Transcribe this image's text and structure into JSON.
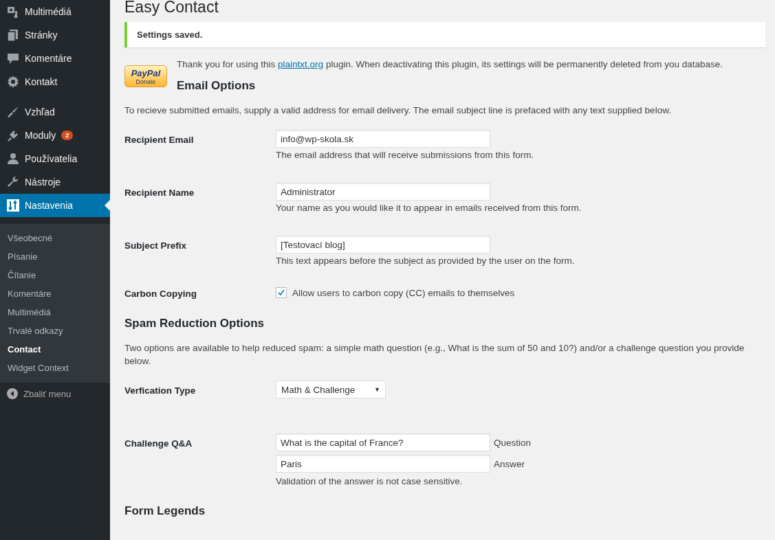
{
  "sidebar": {
    "menu_groups": [
      [
        {
          "label": "Multimédiá",
          "selected": false
        },
        {
          "label": "Stránky",
          "selected": false
        },
        {
          "label": "Komentáre",
          "selected": false
        },
        {
          "label": "Kontakt",
          "selected": false
        }
      ],
      [
        {
          "label": "Vzhľad",
          "selected": false
        },
        {
          "label": "Moduly",
          "selected": false,
          "badge": "2"
        },
        {
          "label": "Používatelia",
          "selected": false
        },
        {
          "label": "Nástroje",
          "selected": false
        },
        {
          "label": "Nastavenia",
          "selected": true
        }
      ]
    ],
    "submenu": [
      {
        "label": "Všeobecné",
        "selected": false
      },
      {
        "label": "Písanie",
        "selected": false
      },
      {
        "label": "Čítanie",
        "selected": false
      },
      {
        "label": "Komentáre",
        "selected": false
      },
      {
        "label": "Multimédiá",
        "selected": false
      },
      {
        "label": "Trvalé odkazy",
        "selected": false
      },
      {
        "label": "Contact",
        "selected": true
      },
      {
        "label": "Widget Context",
        "selected": false
      }
    ],
    "collapse": "Zbaliť menu"
  },
  "page": {
    "title": "Easy Contact",
    "notice": "Settings saved.",
    "donate": {
      "brand": "PayPal",
      "label": "Donate"
    },
    "intro": {
      "before": "Thank you for using this ",
      "link": "plaintxt.org",
      "after": " plugin. When deactivating this plugin, its settings will be permanently deleted from you database."
    },
    "sections": [
      {
        "heading": "Email Options",
        "description": "To recieve submitted emails, supply a valid address for email delivery. The email subject line is prefaced with any text supplied below.",
        "rows": [
          {
            "kind": "text",
            "label": "Recipient Email",
            "value": "info@wp-skola.sk",
            "help": "The email address that will receive submissions from this form."
          },
          {
            "kind": "text",
            "label": "Recipient Name",
            "value": "Administrator",
            "help": "Your name as you would like it to appear in emails received from this form."
          },
          {
            "kind": "text",
            "label": "Subject Prefix",
            "value": "[Testovací blog]",
            "help": "This text appears before the subject as provided by the user on the form."
          },
          {
            "kind": "checkbox",
            "label": "Carbon Copying",
            "checked": true,
            "text": "Allow users to carbon copy (CC) emails to themselves"
          }
        ]
      },
      {
        "heading": "Spam Reduction Options",
        "description": "Two options are available to help reduced spam: a simple math question (e.g., What is the sum of 50 and 10?) and/or a challenge question you provide below.",
        "rows": [
          {
            "kind": "select",
            "label": "Verfication Type",
            "value": "Math & Challenge",
            "arrow": "▼"
          },
          {
            "kind": "qa",
            "label": "Challenge Q&A",
            "question": "What is the capital of France?",
            "question_label": "Question",
            "answer": "Paris",
            "answer_label": "Answer",
            "help": "Validation of the answer is not case sensitive."
          }
        ]
      },
      {
        "heading": "Form Legends"
      }
    ]
  }
}
